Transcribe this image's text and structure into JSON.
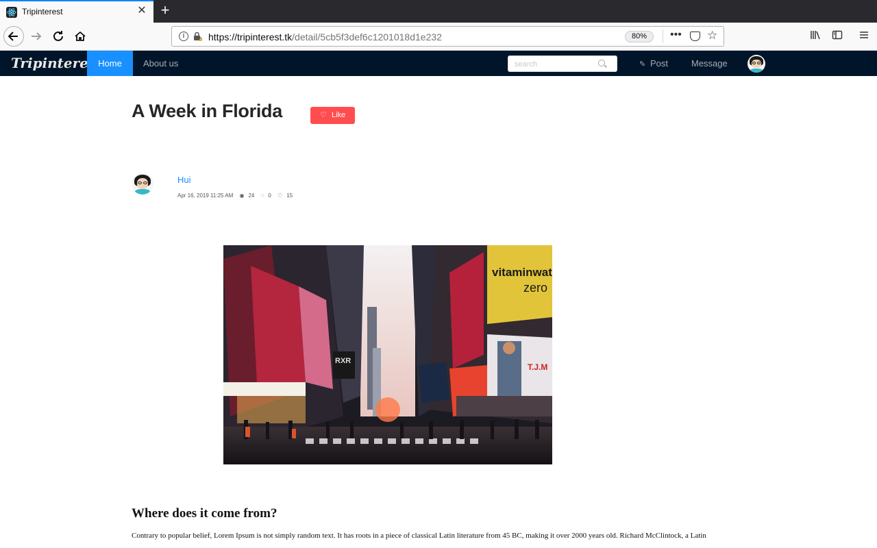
{
  "browser": {
    "tab_title": "Tripinterest",
    "url_main": "https://tripinterest.tk",
    "url_path": "/detail/5cb5f3def6c1201018d1e232",
    "zoom": "80%"
  },
  "site": {
    "logo": "Tripinterest",
    "menu": {
      "home": "Home",
      "about": "About us",
      "post": "Post",
      "message": "Message"
    },
    "search_placeholder": "search"
  },
  "post": {
    "title": "A Week in Florida",
    "like_label": "Like",
    "author": "Hui",
    "date": "Apr 16, 2019 11:25 AM",
    "views": "24",
    "comments": "0",
    "likes": "15",
    "image_text": {
      "billboard_1": "vitaminwater",
      "billboard_2": "zero",
      "billboard_3": "T.J.M",
      "billboard_4": "RXR"
    }
  },
  "article": {
    "heading": "Where does it come from?",
    "body": "Contrary to popular belief, Lorem Ipsum is not simply random text. It has roots in a piece of classical Latin literature from 45 BC, making it over 2000 years old. Richard McClintock, a Latin"
  },
  "colors": {
    "header_bg": "#001529",
    "accent": "#1890ff",
    "like": "#ff4d4f"
  }
}
